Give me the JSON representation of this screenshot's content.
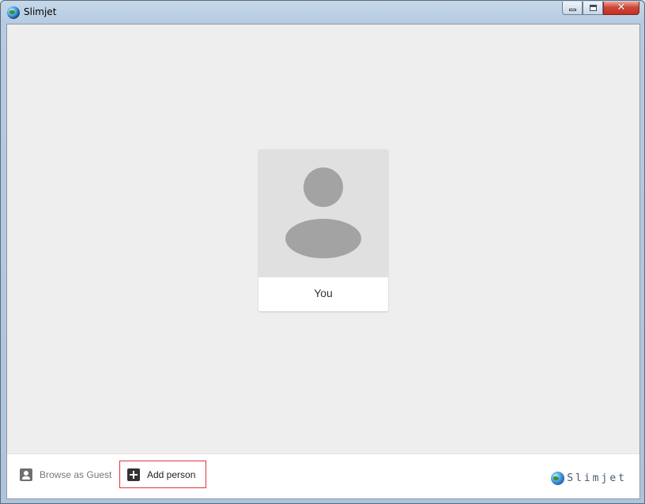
{
  "window": {
    "title": "Slimjet",
    "icon": "slimjet-globe-icon",
    "controls": {
      "minimize_icon": "minimize-icon",
      "maximize_icon": "maximize-icon",
      "close_glyph": "✕"
    }
  },
  "profiles": [
    {
      "name": "You",
      "avatar_icon": "default-person-avatar"
    }
  ],
  "footer": {
    "guest_label": "Browse as Guest",
    "guest_icon": "guest-person-icon",
    "add_label": "Add person",
    "add_icon": "plus-box-icon",
    "brand_text": "Slimjet"
  },
  "colors": {
    "client_background": "#eeeeee",
    "avatar_background": "#e0e0e0",
    "avatar_figure": "#a3a3a3",
    "focus_border": "#d9383a"
  }
}
